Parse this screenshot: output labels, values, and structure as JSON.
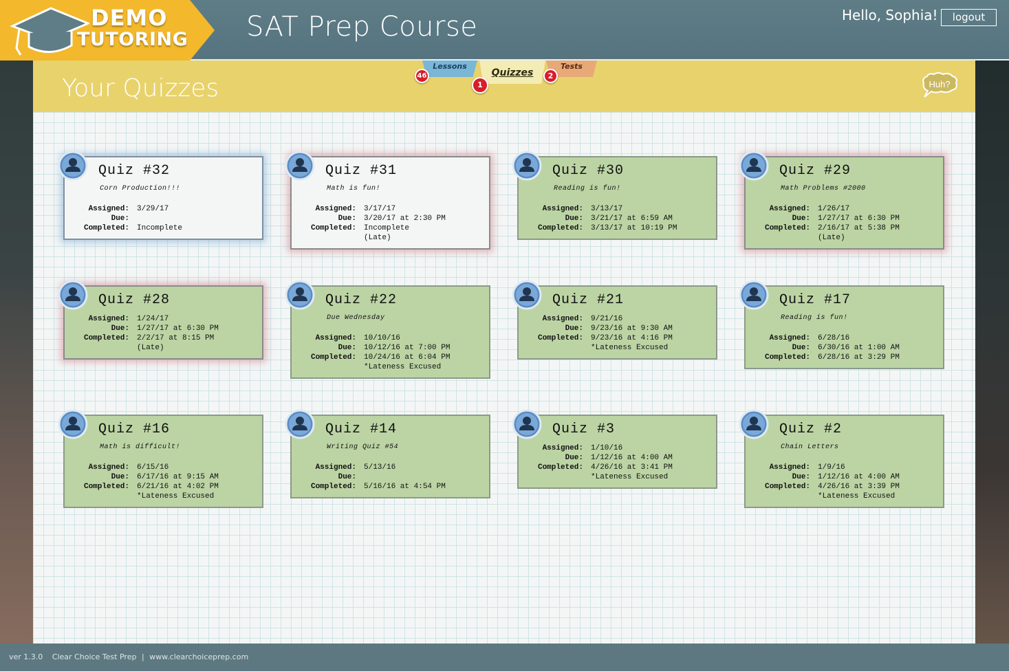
{
  "app": {
    "logo_line1": "DEMO",
    "logo_line2": "TUTORING",
    "title": "SAT Prep Course",
    "greeting": "Hello, Sophia!",
    "logout_label": "logout",
    "brand_color": "#f3b82c",
    "header_color": "#5f7d86"
  },
  "page": {
    "heading": "Your Quizzes",
    "help_label": "Huh?"
  },
  "tabs": [
    {
      "label": "Lessons",
      "badge": "46",
      "color": "#7ab6d6"
    },
    {
      "label": "Quizzes",
      "badge": "1",
      "color": "#f3ecb4",
      "active": true
    },
    {
      "label": "Tests",
      "badge": "2",
      "color": "#e8a978"
    }
  ],
  "quizzes": [
    {
      "title": "Quiz #32",
      "subtitle": "Corn Production!!!",
      "assigned": "3/29/17",
      "due": "",
      "completed": "Incomplete",
      "note": "",
      "status": "incomplete"
    },
    {
      "title": "Quiz #31",
      "subtitle": "Math is fun!",
      "assigned": "3/17/17",
      "due": "3/20/17 at 2:30 PM",
      "completed": "Incomplete",
      "note": "(Late)",
      "status": "late-incomplete"
    },
    {
      "title": "Quiz #30",
      "subtitle": "Reading is fun!",
      "assigned": "3/13/17",
      "due": "3/21/17 at 6:59 AM",
      "completed": "3/13/17 at 10:19 PM",
      "note": "",
      "status": "done"
    },
    {
      "title": "Quiz #29",
      "subtitle": "Math Problems #2000",
      "assigned": "1/26/17",
      "due": "1/27/17 at 6:30 PM",
      "completed": "2/16/17 at 5:38 PM",
      "note": "(Late)",
      "status": "late"
    },
    {
      "title": "Quiz #28",
      "subtitle": "",
      "assigned": "1/24/17",
      "due": "1/27/17 at 6:30 PM",
      "completed": "2/2/17 at 8:15 PM",
      "note": "(Late)",
      "status": "late"
    },
    {
      "title": "Quiz #22",
      "subtitle": "Due Wednesday",
      "assigned": "10/10/16",
      "due": "10/12/16 at 7:00 PM",
      "completed": "10/24/16 at 6:04 PM",
      "note": "*Lateness Excused",
      "status": "done"
    },
    {
      "title": "Quiz #21",
      "subtitle": "",
      "assigned": "9/21/16",
      "due": "9/23/16 at 9:30 AM",
      "completed": "9/23/16 at 4:16 PM",
      "note": "*Lateness Excused",
      "status": "done"
    },
    {
      "title": "Quiz #17",
      "subtitle": "Reading is fun!",
      "assigned": "6/28/16",
      "due": "6/30/16 at 1:00 AM",
      "completed": "6/28/16 at 3:29 PM",
      "note": "",
      "status": "done"
    },
    {
      "title": "Quiz #16",
      "subtitle": "Math is difficult!",
      "assigned": "6/15/16",
      "due": "6/17/16 at 9:15 AM",
      "completed": "6/21/16 at 4:02 PM",
      "note": "*Lateness Excused",
      "status": "done"
    },
    {
      "title": "Quiz #14",
      "subtitle": "Writing Quiz #54",
      "assigned": "5/13/16",
      "due": "",
      "completed": "5/16/16 at 4:54 PM",
      "note": "",
      "status": "done"
    },
    {
      "title": "Quiz #3",
      "subtitle": "",
      "assigned": "1/10/16",
      "due": "1/12/16 at 4:00 AM",
      "completed": "4/26/16 at 3:41 PM",
      "note": "*Lateness Excused",
      "status": "done"
    },
    {
      "title": "Quiz #2",
      "subtitle": "Chain Letters",
      "assigned": "1/9/16",
      "due": "1/12/16 at 4:00 AM",
      "completed": "4/26/16 at 3:39 PM",
      "note": "*Lateness Excused",
      "status": "done"
    }
  ],
  "labels": {
    "assigned": "Assigned:",
    "due": "Due:",
    "completed": "Completed:"
  },
  "footer": {
    "version": "ver 1.3.0",
    "company": "Clear Choice Test Prep",
    "separator": "|",
    "website": "www.clearchoiceprep.com"
  }
}
